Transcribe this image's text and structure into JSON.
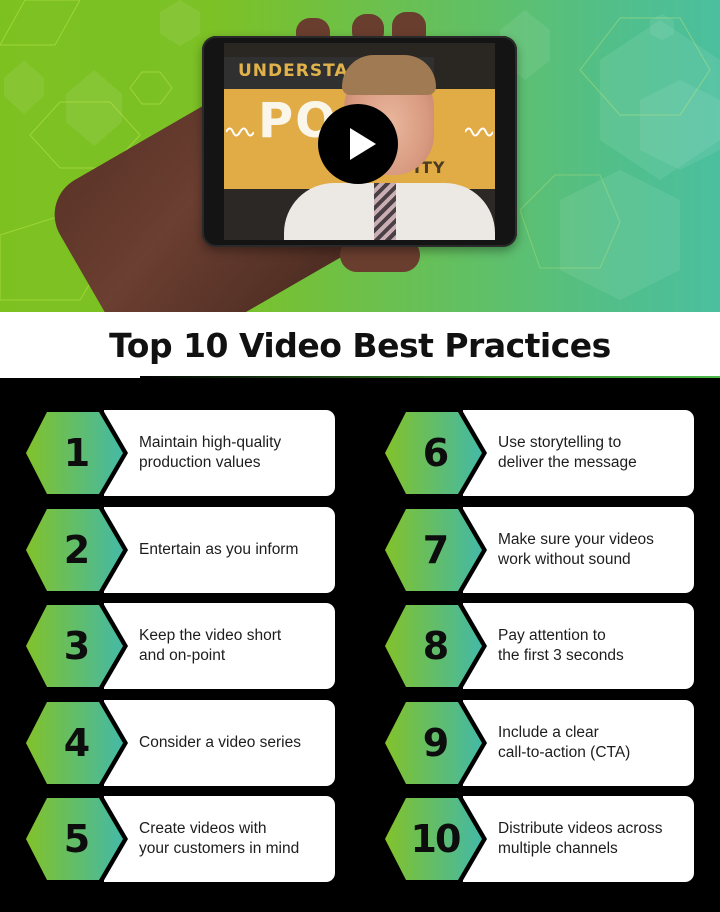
{
  "hero": {
    "video": {
      "banner_top_text": "UNDERSTA    G",
      "banner_main_text": "PO   R",
      "banner_sub_text": "ITY",
      "play_icon": "play-icon"
    },
    "colors": {
      "bg_left": "#7dc121",
      "bg_right": "#4bbf9e"
    }
  },
  "title": "Top 10 Video Best Practices",
  "colors": {
    "hex_gradient_start": "#82c22a",
    "hex_gradient_end": "#44b9a6",
    "card": "#ffffff",
    "background": "#000000"
  },
  "practices": [
    {
      "number": "1",
      "text": "Maintain high-quality\nproduction values"
    },
    {
      "number": "2",
      "text": "Entertain as you inform"
    },
    {
      "number": "3",
      "text": "Keep the video short\nand on-point"
    },
    {
      "number": "4",
      "text": "Consider a video series"
    },
    {
      "number": "5",
      "text": "Create videos with\nyour customers in mind"
    },
    {
      "number": "6",
      "text": "Use storytelling to\ndeliver the message"
    },
    {
      "number": "7",
      "text": "Make sure your videos\nwork without sound"
    },
    {
      "number": "8",
      "text": "Pay attention to\nthe first 3 seconds"
    },
    {
      "number": "9",
      "text": "Include a clear\ncall-to-action (CTA)"
    },
    {
      "number": "10",
      "text": "Distribute videos across\nmultiple channels"
    }
  ]
}
